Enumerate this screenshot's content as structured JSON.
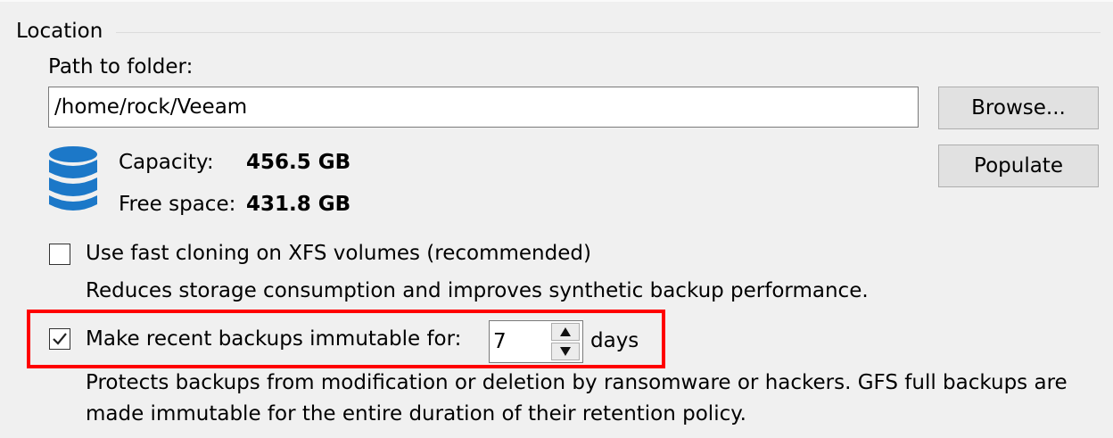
{
  "location": {
    "group_title": "Location",
    "path_label": "Path to folder:",
    "path_value": "/home/rock/Veeam",
    "browse_label": "Browse...",
    "populate_label": "Populate",
    "storage": {
      "icon": "database-icon",
      "capacity_label": "Capacity:",
      "capacity_value": "456.5 GB",
      "free_label": "Free space:",
      "free_value": "431.8 GB"
    }
  },
  "fast_cloning": {
    "checked": false,
    "label": "Use fast cloning on XFS volumes (recommended)",
    "description": "Reduces storage consumption and improves synthetic backup performance."
  },
  "immutable": {
    "checked": true,
    "label": "Make recent backups immutable for:",
    "days_value": "7",
    "days_unit": "days",
    "description_line1": "Protects backups from modification or deletion by ransomware or hackers. GFS full backups are",
    "description_line2": "made immutable for the entire duration of their retention policy."
  },
  "colors": {
    "highlight": "#ff0000",
    "icon_blue": "#1c78c8",
    "window_bg": "#f0f0f0"
  }
}
